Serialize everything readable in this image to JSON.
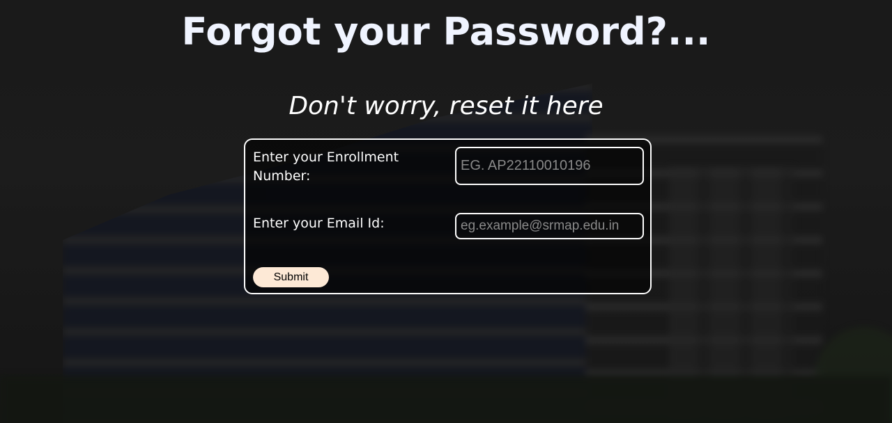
{
  "header": {
    "title": "Forgot your Password?...",
    "subtitle": "Don't worry, reset it here"
  },
  "form": {
    "enrollment_label": "Enter your Enrollment Number:",
    "enrollment_placeholder": "EG. AP22110010196",
    "enrollment_value": "",
    "email_label": "Enter your Email Id:",
    "email_placeholder": "eg.example@srmap.edu.in",
    "email_value": "",
    "submit_label": "Submit"
  },
  "colors": {
    "text": "#ffffff",
    "button_bg": "#fde9d6",
    "placeholder": "#8a8a8a"
  }
}
